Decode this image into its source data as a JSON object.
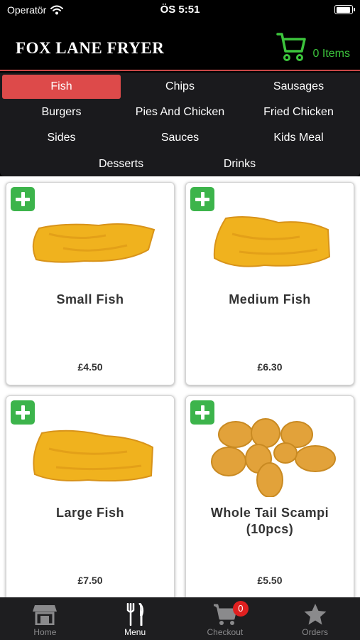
{
  "status_bar": {
    "carrier": "Operatör",
    "time": "ÖS 5:51",
    "battery_level": 0.95
  },
  "header": {
    "title": "FOX LANE FRYER",
    "cart_count_label": "0 Items",
    "accent_color": "#3cc43c"
  },
  "categories": [
    {
      "label": "Fish",
      "active": true
    },
    {
      "label": "Chips",
      "active": false
    },
    {
      "label": "Sausages",
      "active": false
    },
    {
      "label": "Burgers",
      "active": false
    },
    {
      "label": "Pies And Chicken",
      "active": false
    },
    {
      "label": "Fried Chicken",
      "active": false
    },
    {
      "label": "Sides",
      "active": false
    },
    {
      "label": "Sauces",
      "active": false
    },
    {
      "label": "Kids Meal",
      "active": false
    },
    {
      "label": "Desserts",
      "active": false
    },
    {
      "label": "Drinks",
      "active": false
    }
  ],
  "products": [
    {
      "name": "Small Fish",
      "price": "£4.50",
      "image": "battered-fish"
    },
    {
      "name": "Medium Fish",
      "price": "£6.30",
      "image": "battered-fish"
    },
    {
      "name": "Large Fish",
      "price": "£7.50",
      "image": "battered-fish"
    },
    {
      "name": "Whole Tail Scampi (10pcs)",
      "price": "£5.50",
      "image": "scampi-pieces"
    }
  ],
  "tabbar": {
    "items": [
      {
        "label": "Home",
        "icon": "store-icon",
        "active": false
      },
      {
        "label": "Menu",
        "icon": "fork-knife-icon",
        "active": true
      },
      {
        "label": "Checkout",
        "icon": "cart-icon",
        "active": false,
        "badge": "0"
      },
      {
        "label": "Orders",
        "icon": "star-icon",
        "active": false
      }
    ]
  },
  "colors": {
    "active_category": "#dd4a4a",
    "add_button": "#3cb44b",
    "badge": "#e02020"
  }
}
